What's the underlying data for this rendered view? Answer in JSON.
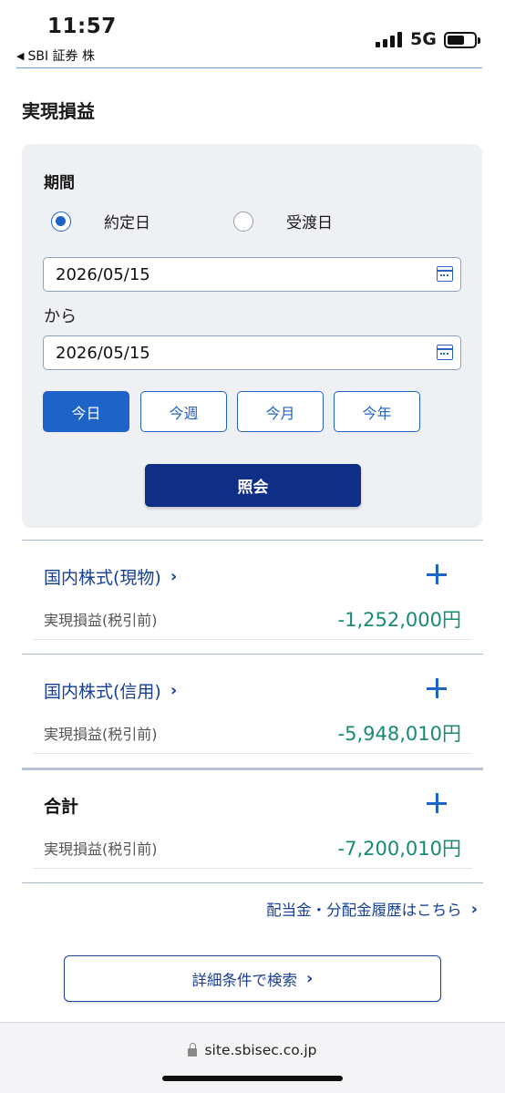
{
  "status_bar": {
    "time": "11:57",
    "back_app": "SBI 証券 株",
    "network": "5G"
  },
  "page": {
    "title": "実現損益"
  },
  "filter": {
    "period_label": "期間",
    "radio_options": [
      {
        "label": "約定日",
        "selected": true
      },
      {
        "label": "受渡日",
        "selected": false
      }
    ],
    "from_date": "2026/05/15",
    "separator": "から",
    "to_date": "2026/05/15",
    "period_buttons": [
      {
        "label": "今日",
        "active": true
      },
      {
        "label": "今週",
        "active": false
      },
      {
        "label": "今月",
        "active": false
      },
      {
        "label": "今年",
        "active": false
      }
    ],
    "submit_label": "照会"
  },
  "sections": [
    {
      "title": "国内株式(現物)",
      "row_label": "実現損益(税引前)",
      "value": "-1,252,000円"
    },
    {
      "title": "国内株式(信用)",
      "row_label": "実現損益(税引前)",
      "value": "-5,948,010円"
    }
  ],
  "total": {
    "title": "合計",
    "row_label": "実現損益(税引前)",
    "value": "-7,200,010円"
  },
  "links": {
    "dividend_history": "配当金・分配金履歴はこちら",
    "advanced_search": "詳細条件で検索"
  },
  "browser": {
    "url": "site.sbisec.co.jp"
  },
  "colors": {
    "accent": "#1e63c8",
    "navy": "#0f2f86",
    "link": "#153f94",
    "value_teal": "#168a74"
  }
}
